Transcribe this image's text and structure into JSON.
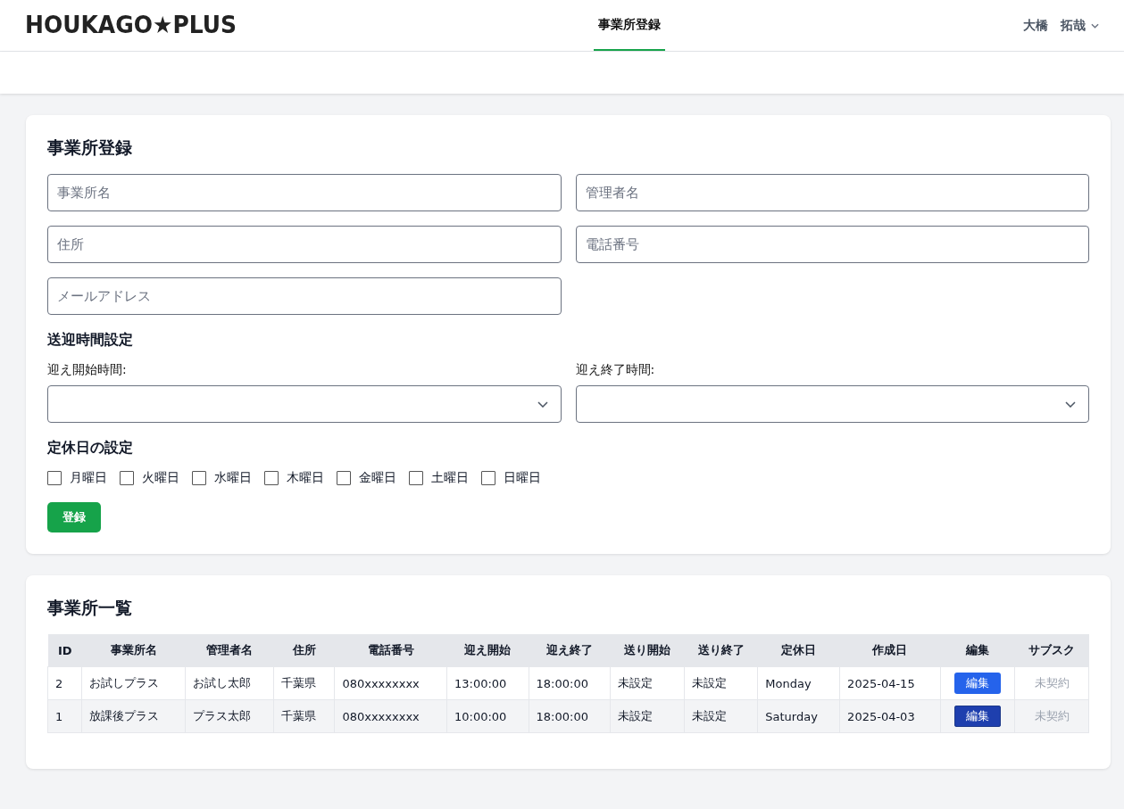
{
  "header": {
    "logo": "HOUKAGO★PLUS",
    "nav": [
      {
        "label": "事業所登録",
        "selected": true
      }
    ],
    "user": {
      "last_name": "大橋",
      "first_name": "拓哉"
    }
  },
  "form": {
    "title": "事業所登録",
    "fields": [
      {
        "placeholder": "事業所名"
      },
      {
        "placeholder": "管理者名"
      },
      {
        "placeholder": "住所"
      },
      {
        "placeholder": "電話番号"
      },
      {
        "placeholder": "メールアドレス"
      }
    ],
    "pickup_title": "送迎時間設定",
    "selects": [
      {
        "label": "迎え開始時間:"
      },
      {
        "label": "迎え終了時間:"
      }
    ],
    "holiday_title": "定休日の設定",
    "days": [
      {
        "label": "月曜日",
        "checked": false
      },
      {
        "label": "火曜日",
        "checked": false
      },
      {
        "label": "水曜日",
        "checked": false
      },
      {
        "label": "木曜日",
        "checked": false
      },
      {
        "label": "金曜日",
        "checked": false
      },
      {
        "label": "土曜日",
        "checked": false
      },
      {
        "label": "日曜日",
        "checked": false
      }
    ],
    "submit": "登録"
  },
  "list": {
    "title": "事業所一覧",
    "columns": [
      "ID",
      "事業所名",
      "管理者名",
      "住所",
      "電話番号",
      "迎え開始",
      "迎え終了",
      "送り開始",
      "送り終了",
      "定休日",
      "作成日",
      "編集",
      "サブスク"
    ],
    "rows": [
      {
        "cells": [
          "2",
          "お試しプラス",
          "お試し太郎",
          "千葉県",
          "080xxxxxxxx",
          "13:00:00",
          "18:00:00",
          "未設定",
          "未設定",
          "Monday",
          "2025-04-15"
        ],
        "edit": "編集",
        "hovered": false,
        "subscription": "未契約"
      },
      {
        "cells": [
          "1",
          "放課後プラス",
          "プラス太郎",
          "千葉県",
          "080xxxxxxxx",
          "10:00:00",
          "18:00:00",
          "未設定",
          "未設定",
          "Saturday",
          "2025-04-03"
        ],
        "edit": "編集",
        "hovered": true,
        "subscription": "未契約"
      }
    ]
  }
}
